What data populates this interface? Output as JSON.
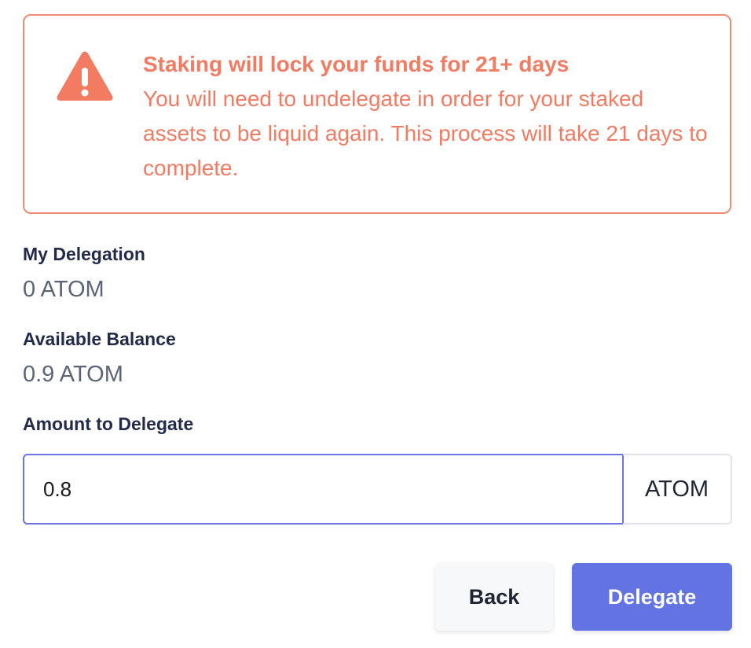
{
  "warning": {
    "icon": "warning-triangle-icon",
    "color": "#f27b62",
    "title": "Staking will lock your funds for 21+ days",
    "body": "You will need to undelegate in order for your staked assets to be liquid again. This process will take 21 days to complete."
  },
  "my_delegation": {
    "label": "My Delegation",
    "value": "0 ATOM"
  },
  "available_balance": {
    "label": "Available Balance",
    "value": "0.9 ATOM"
  },
  "amount": {
    "label": "Amount to Delegate",
    "value": "0.8",
    "unit": "ATOM"
  },
  "buttons": {
    "back_label": "Back",
    "delegate_label": "Delegate",
    "delegate_color": "#6374e2"
  }
}
